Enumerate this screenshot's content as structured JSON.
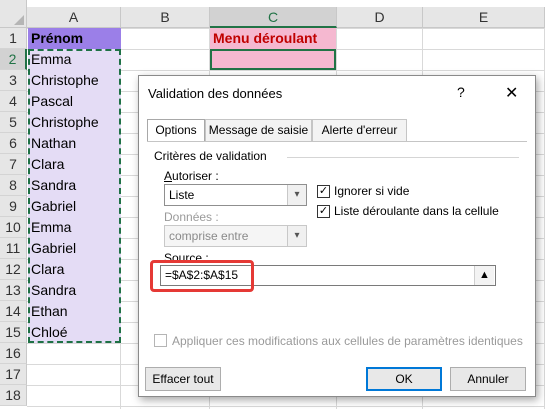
{
  "sheet": {
    "columns": [
      "A",
      "B",
      "C",
      "D",
      "E"
    ],
    "rows": [
      "1",
      "2",
      "3",
      "4",
      "5",
      "6",
      "7",
      "8",
      "9",
      "10",
      "11",
      "12",
      "13",
      "14",
      "15",
      "16",
      "17",
      "18"
    ],
    "a_header": "Prénom",
    "names": [
      "Emma",
      "Christophe",
      "Pascal",
      "Christophe",
      "Nathan",
      "Clara",
      "Sandra",
      "Gabriel",
      "Emma",
      "Gabriel",
      "Clara",
      "Sandra",
      "Ethan",
      "Chloé"
    ],
    "c_header": "Menu déroulant",
    "colors": {
      "header_purple": "#9b7fe8",
      "name_fill": "#e4dcf5",
      "pink": "#f5b8d0",
      "header_text_red": "#c00000",
      "selection_green": "#217346"
    }
  },
  "dialog": {
    "title": "Validation des données",
    "help": "?",
    "close": "✕",
    "tabs": [
      "Options",
      "Message de saisie",
      "Alerte d'erreur"
    ],
    "section_title": "Critères de validation",
    "allow_label": "Autoriser :",
    "allow_value": "Liste",
    "data_label": "Données :",
    "data_value": "comprise entre",
    "ignore_blank_label": "Ignorer si vide",
    "ignore_blank_checked": "✓",
    "dropdown_label": "Liste déroulante dans la cellule",
    "dropdown_checked": "✓",
    "source_label": "Source :",
    "source_value": "=$A$2:$A$15",
    "collapse_icon": "collapse-arrow-icon",
    "apply_label": "Appliquer ces modifications aux cellules de paramètres identiques",
    "clear_all": "Effacer tout",
    "ok": "OK",
    "cancel": "Annuler"
  }
}
